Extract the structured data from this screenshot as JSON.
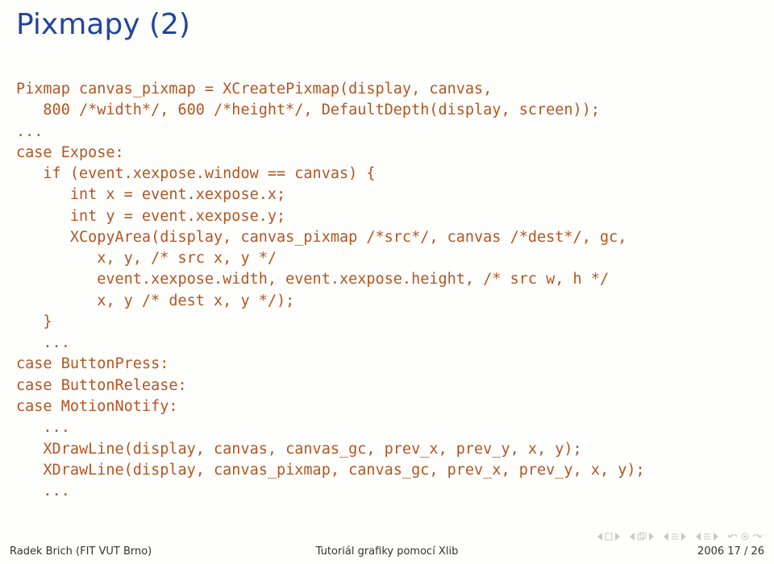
{
  "title": "Pixmapy (2)",
  "code": "Pixmap canvas_pixmap = XCreatePixmap(display, canvas,\n   800 /*width*/, 600 /*height*/, DefaultDepth(display, screen));\n...\ncase Expose:\n   if (event.xexpose.window == canvas) {\n      int x = event.xexpose.x;\n      int y = event.xexpose.y;\n      XCopyArea(display, canvas_pixmap /*src*/, canvas /*dest*/, gc,\n         x, y, /* src x, y */\n         event.xexpose.width, event.xexpose.height, /* src w, h */\n         x, y /* dest x, y */);\n   }\n   ...\ncase ButtonPress:\ncase ButtonRelease:\ncase MotionNotify:\n   ...\n   XDrawLine(display, canvas, canvas_gc, prev_x, prev_y, x, y);\n   XDrawLine(display, canvas_pixmap, canvas_gc, prev_x, prev_y, x, y);\n   ...",
  "footer": {
    "author": "Radek Brich (FIT VUT Brno)",
    "center": "Tutoriál grafiky pomocí Xlib",
    "right": "2006     17 / 26"
  }
}
